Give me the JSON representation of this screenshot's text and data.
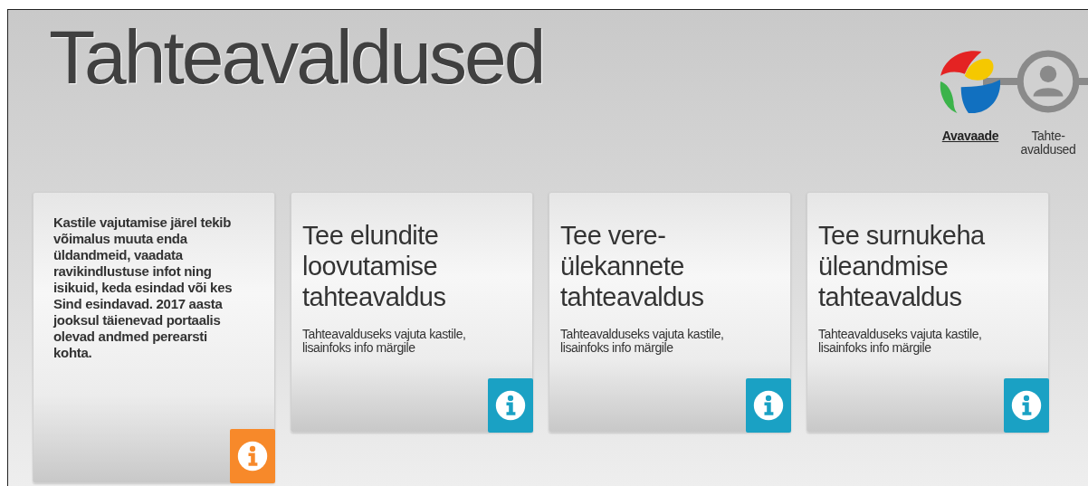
{
  "page_title": "Tahteavaldused",
  "breadcrumb": [
    {
      "label": "Avavaade",
      "kind": "home",
      "selected": false
    },
    {
      "label": "Tahte-\navaldused",
      "kind": "person",
      "selected": true
    }
  ],
  "cards": [
    {
      "kind": "text",
      "text": "Kastile vajutamise järel tekib võimalus muuta enda üldandmeid, vaadata ravikindlustuse infot ning isikuid, keda esindad või kes Sind esindavad. 2017 aasta jooksul täienevad portaalis olevad andmed perearsti kohta.",
      "color": "#f7892a"
    },
    {
      "kind": "title",
      "title": "Tee elundite loovutamise tahteavaldus",
      "text": "Tahteavalduseks vajuta kastile, lisainfoks info märgile",
      "color": "#1aa1c4"
    },
    {
      "kind": "title",
      "title": "Tee vere-\nülekannete tahteavaldus",
      "text": "Tahteavalduseks vajuta kastile, lisainfoks info märgile",
      "color": "#1aa1c4"
    },
    {
      "kind": "title",
      "title": "Tee surnukeha üleandmise tahteavaldus",
      "text": "Tahteavalduseks vajuta kastile, lisainfoks info märgile",
      "color": "#1aa1c4"
    }
  ]
}
